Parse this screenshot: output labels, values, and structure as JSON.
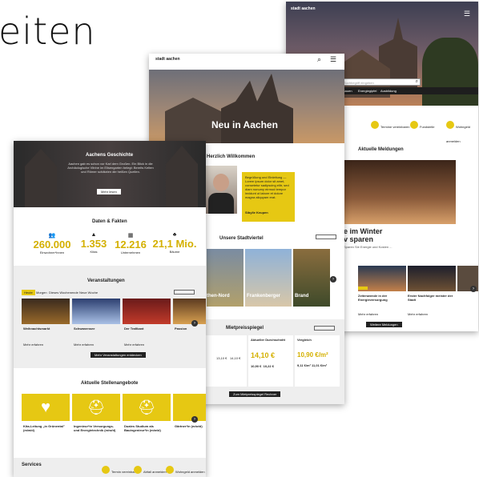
{
  "heading_fragment": "eiten",
  "card1": {
    "logo": "stadt aachen",
    "search_placeholder": "Suchbegriff eingeben",
    "nav": [
      "Bauen",
      "Energiegipfel",
      "Ausbildung"
    ],
    "tabs": [
      "Termine vereinbaren",
      "Fundstelle",
      "Wohngeld anmelden"
    ],
    "section": "Aktuelle Meldungen",
    "headline_a": "e im Winter",
    "headline_b": "v sparen",
    "news": [
      {
        "title": "Zeitenwende in der Energieversorgung",
        "link": "Mehr erfahren"
      },
      {
        "title": "Erster Nachfolger meister der Stadt",
        "link": "Mehr erfahren"
      }
    ],
    "more_btn": "Weitere Meldungen"
  },
  "card2": {
    "logo": "stadt aachen",
    "hero": "Neu in Aachen",
    "welcome": "Herzlich Willkommen",
    "quote": "Begrüßung und Einleitung — Lorem ipsum dolor sit amet, consetetur sadipscing elitr, sed diam nonumy eirmod tempor invidunt ut labore et dolore magna aliquyam erat.",
    "signature": "Sibylle Keupen",
    "districts_title": "Unsere Stadtviertel",
    "districts": [
      "then-Nord",
      "Frankenberger",
      "Brand"
    ],
    "rent_title": "Mietpreisspiegel",
    "rent_btn": "Zum Mietpreisspiegel Rechner",
    "rent": [
      {
        "label": "Aktueller Durchschnitt",
        "value": "14,10 €",
        "sub1": "10,90 €",
        "sub2": "10,22 €"
      },
      {
        "label": "Vergleich",
        "value": "10,90 €/m²",
        "sub1": "9,11 €/m²",
        "sub2": "11,01 €/m²"
      }
    ],
    "chart_labels": [
      "13,10 €",
      "14,10 €"
    ]
  },
  "card3": {
    "hero_title": "Aachens Geschichte",
    "hero_text": "Aachen gab es schon vor Karl dem Großen. Ein Blick in die Archäologische Vitrine im Elisengarten belegt: Bereits Kelten und Römer schätzten die heißen Quellen.",
    "hero_btn": "Mehr lesen",
    "facts_title": "Daten & Fakten",
    "facts": [
      {
        "value": "260.000",
        "label": "Einwohner*innen"
      },
      {
        "value": "1.353",
        "label": "Kitas"
      },
      {
        "value": "12.216",
        "label": "Unternehmen"
      },
      {
        "value": "21,1 Mio.",
        "label": "Bäume"
      }
    ],
    "events_title": "Veranstaltungen",
    "event_tabs": [
      "Heute",
      "Morgen",
      "Dieses Wochenende",
      "Neue Woche"
    ],
    "events": [
      {
        "title": "Weihnachtsmarkt",
        "link": "Mehr erfahren"
      },
      {
        "title": "Schwanensee",
        "link": "Mehr erfahren"
      },
      {
        "title": "Der Trafikant",
        "link": "Mehr erfahren"
      },
      {
        "title": "Passion",
        "link": "Mehr erfahren"
      }
    ],
    "events_btn": "Mehr Veranstaltungen entdecken",
    "jobs_title": "Aktuelle Stellenangebote",
    "jobs": [
      {
        "title": "Kita-Leitung „in Grünental\" (m/w/d)"
      },
      {
        "title": "Ingenieur*in Versorgungs- und Energietechnik (m/w/d)"
      },
      {
        "title": "Duales Studium als Bauingenieur*in (m/w/d)"
      },
      {
        "title": "Gärtner*in (m/w/d)"
      }
    ],
    "services_title": "Services",
    "services": [
      "Termin vereinbaren",
      "Abfall anmelden",
      "Wohngeld anmelden"
    ]
  }
}
